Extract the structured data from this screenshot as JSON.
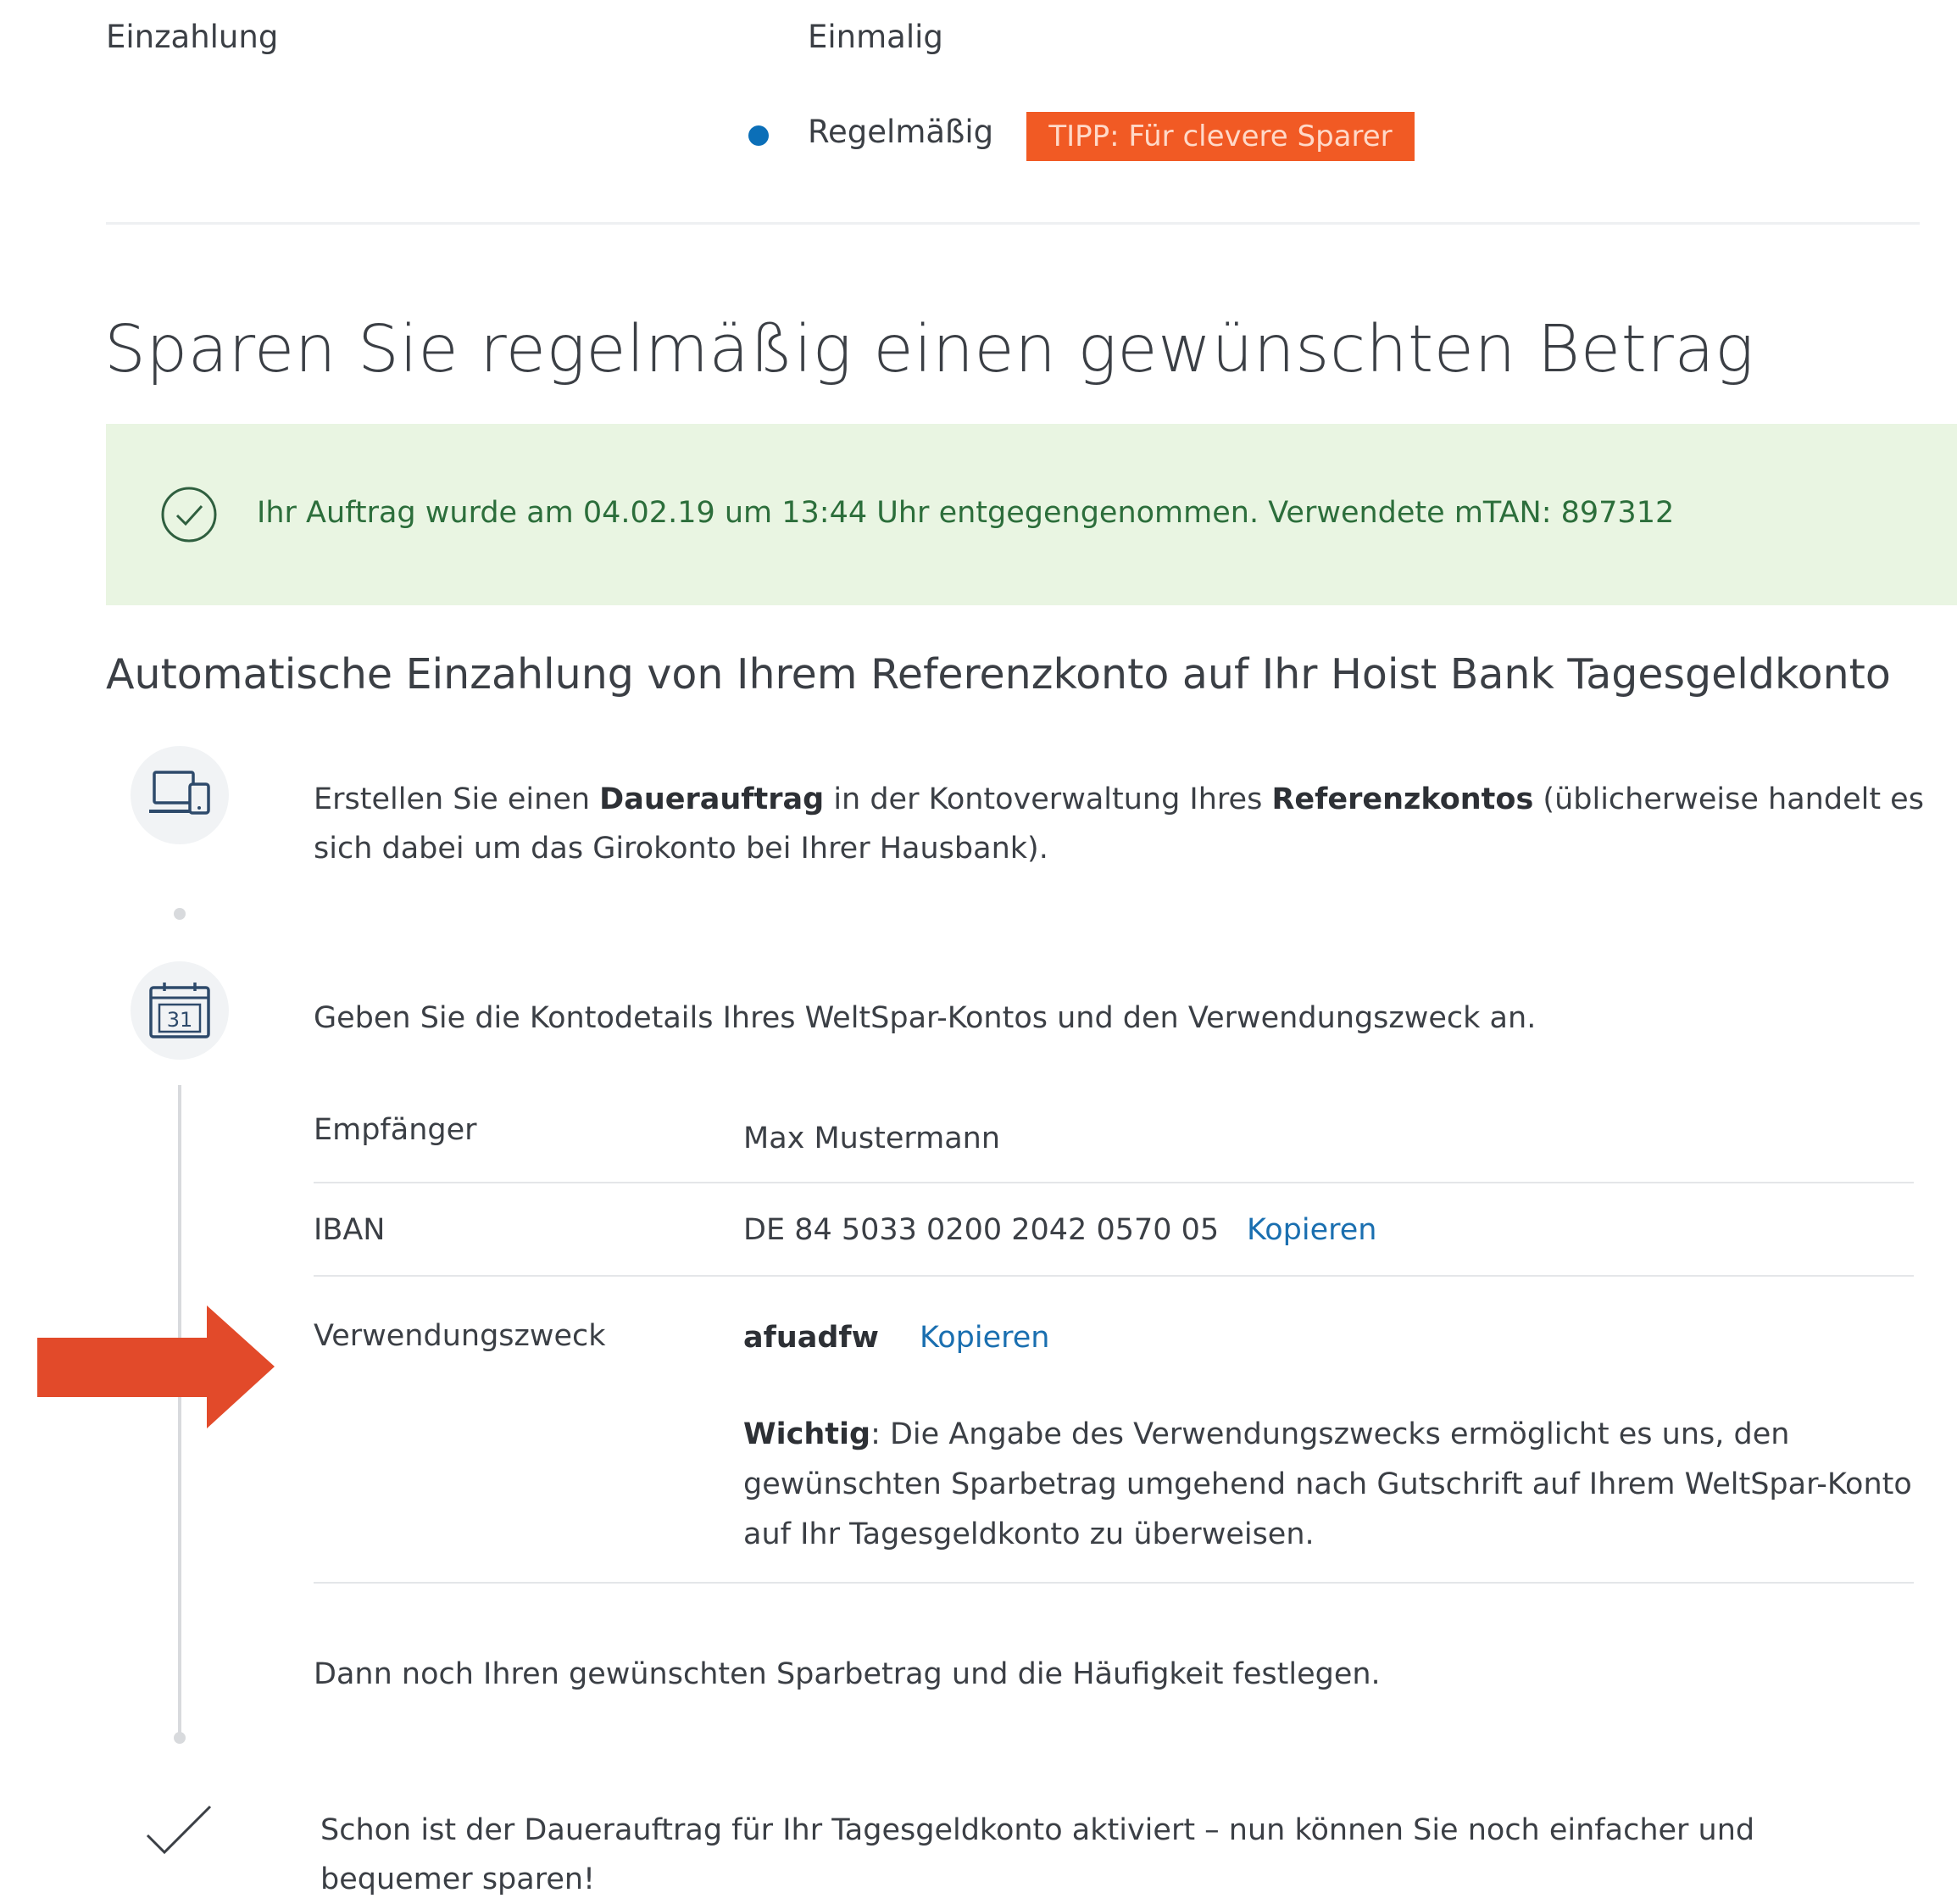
{
  "deposit": {
    "label": "Einzahlung",
    "option_once": "Einmalig",
    "option_regular": "Regelmäßig",
    "tip_badge": "TIPP: Für clevere Sparer",
    "selected": "Regelmäßig"
  },
  "heading": "Sparen Sie regelmäßig einen gewünschten Betrag",
  "notice": {
    "text": "Ihr Auftrag wurde am 04.02.19 um 13:44 Uhr entgegengenommen. Verwendete mTAN: 897312",
    "icon": "check-circle-icon",
    "color": "#e9f5e2"
  },
  "subheading": "Automatische Einzahlung von Ihrem Referenzkonto auf Ihr Hoist Bank Tagesgeldkonto",
  "steps": {
    "step1": {
      "icon": "devices-icon",
      "text_before": "Erstellen Sie einen ",
      "bold1": "Dauerauftrag",
      "text_mid": "  in der Kontoverwaltung Ihres ",
      "bold2": "Referenzkontos",
      "text_after": " (üblicherweise handelt es sich dabei um das Girokonto bei Ihrer Hausbank)."
    },
    "step2": {
      "icon": "calendar-icon",
      "calendar_day": "31",
      "text": "Geben Sie die Kontodetails Ihres WeltSpar-Kontos und den Verwendungszweck an."
    },
    "step3": {
      "text": "Dann noch Ihren gewünschten Sparbetrag und die Häufigkeit festlegen."
    },
    "step4": {
      "icon": "checkmark-icon",
      "text": "Schon ist der Dauerauftrag für Ihr Tagesgeldkonto aktiviert – nun können Sie noch einfacher und bequemer sparen!"
    }
  },
  "details": {
    "recipient_label": "Empfänger",
    "recipient_value": "Max Mustermann",
    "iban_label": "IBAN",
    "iban_value": "DE 84 5033 0200 2042 0570 05",
    "purpose_label": "Verwendungszweck",
    "purpose_value": "afuadfw",
    "copy_label": "Kopieren",
    "note_bold": "Wichtig",
    "note_text": ": Die Angabe des Verwendungszwecks ermöglicht es uns, den gewünschten Sparbetrag umgehend nach Gutschrift auf Ihrem WeltSpar-Konto auf Ihr Tagesgeldkonto zu überweisen."
  },
  "colors": {
    "accent_blue": "#1a6fb0",
    "radio_blue": "#0b6fb8",
    "tip_orange": "#f15a24",
    "arrow_red": "#e24a2a",
    "success_green": "#2c6e3b"
  }
}
